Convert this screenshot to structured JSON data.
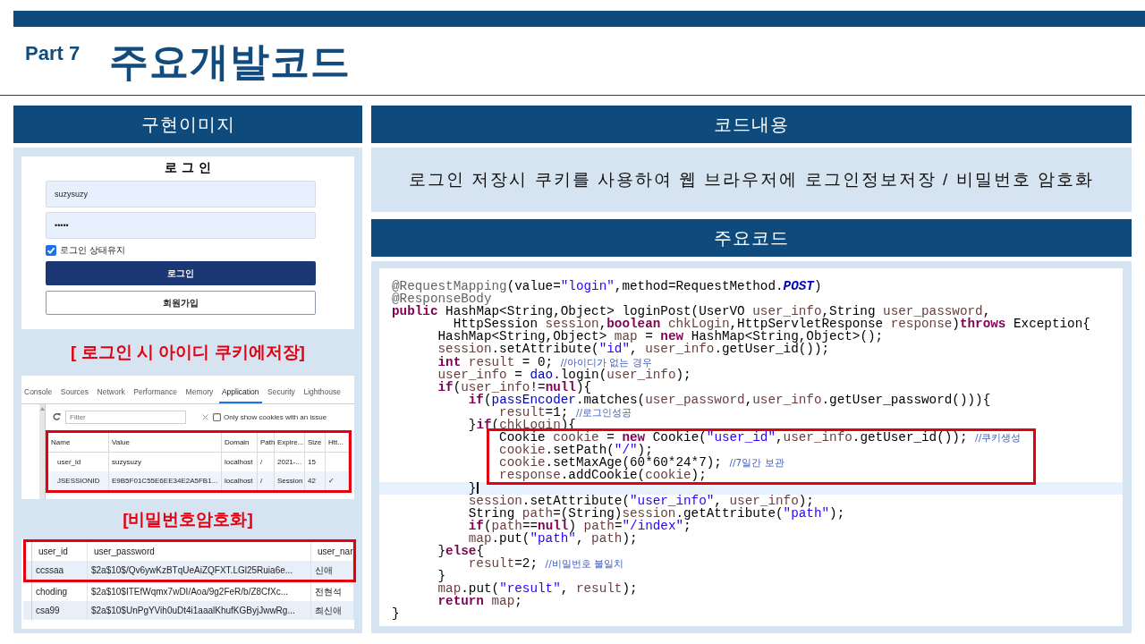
{
  "header": {
    "part": "Part 7",
    "title": "주요개발코드"
  },
  "left": {
    "heading": "구현이미지",
    "login_form": {
      "title": "로그인",
      "username": "suzysuzy",
      "password": "•••••",
      "remember": {
        "label": "로그인 상태유지",
        "checked": true
      },
      "buttons": [
        {
          "label": "로그인",
          "kind": "primary"
        },
        {
          "label": "회원가입",
          "kind": "outline"
        }
      ]
    },
    "caption_1": "[ 로그인 시 아이디 쿠키에저장]",
    "devtools": {
      "tabs": [
        {
          "label": "Console",
          "selected": false
        },
        {
          "label": "Sources",
          "selected": false
        },
        {
          "label": "Network",
          "selected": false
        },
        {
          "label": "Performance",
          "selected": false
        },
        {
          "label": "Memory",
          "selected": false
        },
        {
          "label": "Application",
          "selected": true
        },
        {
          "label": "Security",
          "selected": false
        },
        {
          "label": "Lighthouse",
          "selected": false
        }
      ],
      "filter": {
        "placeholder": "Filter"
      },
      "issue_filter": {
        "label": "Only show cookies with an issue",
        "checked": false
      },
      "cookies": {
        "highlighted": true,
        "columns": [
          "Name",
          "Value",
          "Domain",
          "Path",
          "Expire...",
          "Size",
          "Htt..."
        ],
        "rows": [
          {
            "cells": [
              "user_id",
              "suzysuzy",
              "localhost",
              "/",
              "2021-...",
              "15"
            ]
          },
          {
            "cells": [
              "JSESSIONID",
              "E9B5F01C55E6EE34E2A5FB1...",
              "localhost",
              "/",
              "Session",
              "42",
              "✓"
            ]
          }
        ]
      }
    },
    "caption_2": "[비밀번호암호화]",
    "user_table": {
      "columns": [
        "user_id",
        "user_password",
        "user_nar"
      ],
      "rows": [
        {
          "cells": [
            "ccssaa",
            "$2a$10$/Qv6ywKzBTqUeAiZQFXT.LGl25Ruia6e...",
            "신애"
          ],
          "highlighted": true
        },
        {
          "cells": [
            "choding",
            "$2a$10$ITEfWqmx7wDI/Aoa/9g2FeR/b/Z8CfXc...",
            "전현석"
          ],
          "highlighted": false
        },
        {
          "cells": [
            "csa99",
            "$2a$10$UnPgYVih0uDt4i1aaalKhufKGByjJwwRg...",
            "최신애"
          ],
          "highlighted": false
        }
      ]
    }
  },
  "right": {
    "heading": "코드내용",
    "description": "로그인 저장시 쿠키를 사용하여 웹 브라우저에 로그인정보저장 / 비밀번호 암호화",
    "code_heading": "주요코드",
    "code": {
      "lines": [
        {
          "kind": "code",
          "current": false,
          "tokens": [
            {
              "kind": "annotation",
              "text": "@RequestMapping"
            },
            {
              "kind": "plain",
              "text": "(value="
            },
            {
              "kind": "string",
              "text": "\"login\""
            },
            {
              "kind": "plain",
              "text": ",method=RequestMethod."
            },
            {
              "kind": "constant",
              "text": "POST"
            },
            {
              "kind": "plain",
              "text": ")"
            }
          ]
        },
        {
          "kind": "code",
          "current": false,
          "tokens": [
            {
              "kind": "annotation",
              "text": "@ResponseBody"
            }
          ]
        },
        {
          "kind": "code",
          "current": false,
          "tokens": [
            {
              "kind": "keyword",
              "text": "public"
            },
            {
              "kind": "plain",
              "text": " HashMap<String,Object> loginPost(UserVO "
            },
            {
              "kind": "variable",
              "text": "user_info"
            },
            {
              "kind": "plain",
              "text": ",String "
            },
            {
              "kind": "variable",
              "text": "user_password"
            },
            {
              "kind": "plain",
              "text": ","
            }
          ],
          "children": [
            {
              "kind": "wrap",
              "current": false,
              "tokens": [
                {
                  "kind": "plain",
                  "text": "HttpSession "
                },
                {
                  "kind": "variable",
                  "text": "session"
                },
                {
                  "kind": "plain",
                  "text": ","
                },
                {
                  "kind": "keyword",
                  "text": "boolean "
                },
                {
                  "kind": "variable",
                  "text": "chkLogin"
                },
                {
                  "kind": "plain",
                  "text": ",HttpServletResponse "
                },
                {
                  "kind": "variable",
                  "text": "response"
                },
                {
                  "kind": "plain",
                  "text": ")"
                },
                {
                  "kind": "keyword",
                  "text": "throws"
                },
                {
                  "kind": "plain",
                  "text": " Exception{"
                }
              ]
            },
            {
              "kind": "code",
              "current": false,
              "tokens": [
                {
                  "kind": "plain",
                  "text": "HashMap<String,Object> "
                },
                {
                  "kind": "variable",
                  "text": "map"
                },
                {
                  "kind": "plain",
                  "text": " = "
                },
                {
                  "kind": "keyword",
                  "text": "new"
                },
                {
                  "kind": "plain",
                  "text": " HashMap<String,Object>();"
                }
              ]
            },
            {
              "kind": "code",
              "current": false,
              "tokens": [
                {
                  "kind": "variable",
                  "text": "session"
                },
                {
                  "kind": "plain",
                  "text": ".setAttribute("
                },
                {
                  "kind": "string",
                  "text": "\"id\""
                },
                {
                  "kind": "plain",
                  "text": ", "
                },
                {
                  "kind": "variable",
                  "text": "user_info"
                },
                {
                  "kind": "plain",
                  "text": ".getUser_id());"
                }
              ]
            },
            {
              "kind": "code",
              "current": false,
              "tokens": [
                {
                  "kind": "keyword",
                  "text": "int "
                },
                {
                  "kind": "variable",
                  "text": "result"
                },
                {
                  "kind": "plain",
                  "text": " = 0; "
                },
                {
                  "kind": "comment",
                  "text": "//아이디가 없는 경우"
                }
              ]
            },
            {
              "kind": "code",
              "current": false,
              "tokens": [
                {
                  "kind": "variable",
                  "text": "user_info"
                },
                {
                  "kind": "plain",
                  "text": " = "
                },
                {
                  "kind": "field",
                  "text": "dao"
                },
                {
                  "kind": "plain",
                  "text": ".login("
                },
                {
                  "kind": "variable",
                  "text": "user_info"
                },
                {
                  "kind": "plain",
                  "text": ");"
                }
              ]
            },
            {
              "kind": "code",
              "current": false,
              "tokens": [
                {
                  "kind": "keyword",
                  "text": "if"
                },
                {
                  "kind": "plain",
                  "text": "("
                },
                {
                  "kind": "variable",
                  "text": "user_info"
                },
                {
                  "kind": "plain",
                  "text": "!="
                },
                {
                  "kind": "keyword",
                  "text": "null"
                },
                {
                  "kind": "plain",
                  "text": "){"
                }
              ],
              "children": [
                {
                  "kind": "code",
                  "current": false,
                  "tokens": [
                    {
                      "kind": "keyword",
                      "text": "if"
                    },
                    {
                      "kind": "plain",
                      "text": "("
                    },
                    {
                      "kind": "field",
                      "text": "passEncoder"
                    },
                    {
                      "kind": "plain",
                      "text": ".matches("
                    },
                    {
                      "kind": "variable",
                      "text": "user_password"
                    },
                    {
                      "kind": "plain",
                      "text": ","
                    },
                    {
                      "kind": "variable",
                      "text": "user_info"
                    },
                    {
                      "kind": "plain",
                      "text": ".getUser_password())){"
                    }
                  ],
                  "children": [
                    {
                      "kind": "code",
                      "current": false,
                      "tokens": [
                        {
                          "kind": "variable",
                          "text": "result"
                        },
                        {
                          "kind": "plain",
                          "text": "=1; "
                        },
                        {
                          "kind": "comment",
                          "text": "//로그인성공"
                        }
                      ]
                    }
                  ]
                },
                {
                  "kind": "code",
                  "current": false,
                  "tokens": [
                    {
                      "kind": "plain",
                      "text": "}"
                    },
                    {
                      "kind": "keyword",
                      "text": "if"
                    },
                    {
                      "kind": "plain",
                      "text": "("
                    },
                    {
                      "kind": "variable",
                      "text": "chkLogin"
                    },
                    {
                      "kind": "plain",
                      "text": "){"
                    }
                  ],
                  "children": [
                    {
                      "kind": "box",
                      "lines": [
                        {
                          "kind": "code",
                          "current": false,
                          "tokens": [
                            {
                              "kind": "plain",
                              "text": "Cookie "
                            },
                            {
                              "kind": "variable",
                              "text": "cookie"
                            },
                            {
                              "kind": "plain",
                              "text": " = "
                            },
                            {
                              "kind": "keyword",
                              "text": "new"
                            },
                            {
                              "kind": "plain",
                              "text": " Cookie("
                            },
                            {
                              "kind": "string",
                              "text": "\"user_id\""
                            },
                            {
                              "kind": "plain",
                              "text": ","
                            },
                            {
                              "kind": "variable",
                              "text": "user_info"
                            },
                            {
                              "kind": "plain",
                              "text": ".getUser_id()); "
                            },
                            {
                              "kind": "comment",
                              "text": "//쿠키생성"
                            }
                          ]
                        },
                        {
                          "kind": "code",
                          "current": false,
                          "tokens": [
                            {
                              "kind": "variable",
                              "text": "cookie"
                            },
                            {
                              "kind": "plain",
                              "text": ".setPath("
                            },
                            {
                              "kind": "string",
                              "text": "\"/\""
                            },
                            {
                              "kind": "plain",
                              "text": ");"
                            }
                          ]
                        },
                        {
                          "kind": "code",
                          "current": false,
                          "tokens": [
                            {
                              "kind": "variable",
                              "text": "cookie"
                            },
                            {
                              "kind": "plain",
                              "text": ".setMaxAge(60*60*24*7); "
                            },
                            {
                              "kind": "comment",
                              "text": "//7일간 보관"
                            }
                          ]
                        },
                        {
                          "kind": "code",
                          "current": false,
                          "tokens": [
                            {
                              "kind": "variable",
                              "text": "response"
                            },
                            {
                              "kind": "plain",
                              "text": ".addCookie("
                            },
                            {
                              "kind": "variable",
                              "text": "cookie"
                            },
                            {
                              "kind": "plain",
                              "text": ");"
                            }
                          ]
                        }
                      ]
                    }
                  ]
                },
                {
                  "kind": "code",
                  "current": true,
                  "tokens": [
                    {
                      "kind": "plain",
                      "text": "}"
                    }
                  ]
                },
                {
                  "kind": "code",
                  "current": false,
                  "tokens": [
                    {
                      "kind": "variable",
                      "text": "session"
                    },
                    {
                      "kind": "plain",
                      "text": ".setAttribute("
                    },
                    {
                      "kind": "string",
                      "text": "\"user_info\""
                    },
                    {
                      "kind": "plain",
                      "text": ", "
                    },
                    {
                      "kind": "variable",
                      "text": "user_info"
                    },
                    {
                      "kind": "plain",
                      "text": ");"
                    }
                  ]
                },
                {
                  "kind": "code",
                  "current": false,
                  "tokens": [
                    {
                      "kind": "plain",
                      "text": "String "
                    },
                    {
                      "kind": "variable",
                      "text": "path"
                    },
                    {
                      "kind": "plain",
                      "text": "=(String)"
                    },
                    {
                      "kind": "variable",
                      "text": "session"
                    },
                    {
                      "kind": "plain",
                      "text": ".getAttribute("
                    },
                    {
                      "kind": "string",
                      "text": "\"path\""
                    },
                    {
                      "kind": "plain",
                      "text": ");"
                    }
                  ]
                },
                {
                  "kind": "code",
                  "current": false,
                  "tokens": [
                    {
                      "kind": "keyword",
                      "text": "if"
                    },
                    {
                      "kind": "plain",
                      "text": "("
                    },
                    {
                      "kind": "variable",
                      "text": "path"
                    },
                    {
                      "kind": "plain",
                      "text": "=="
                    },
                    {
                      "kind": "keyword",
                      "text": "null"
                    },
                    {
                      "kind": "plain",
                      "text": ") "
                    },
                    {
                      "kind": "variable",
                      "text": "path"
                    },
                    {
                      "kind": "plain",
                      "text": "="
                    },
                    {
                      "kind": "string",
                      "text": "\"/index\""
                    },
                    {
                      "kind": "plain",
                      "text": ";"
                    }
                  ]
                },
                {
                  "kind": "code",
                  "current": false,
                  "tokens": [
                    {
                      "kind": "variable",
                      "text": "map"
                    },
                    {
                      "kind": "plain",
                      "text": ".put("
                    },
                    {
                      "kind": "string",
                      "text": "\"path\""
                    },
                    {
                      "kind": "plain",
                      "text": ", "
                    },
                    {
                      "kind": "variable",
                      "text": "path"
                    },
                    {
                      "kind": "plain",
                      "text": ");"
                    }
                  ]
                }
              ]
            },
            {
              "kind": "code",
              "current": false,
              "tokens": [
                {
                  "kind": "plain",
                  "text": "}"
                },
                {
                  "kind": "keyword",
                  "text": "else"
                },
                {
                  "kind": "plain",
                  "text": "{"
                }
              ],
              "children": [
                {
                  "kind": "code",
                  "current": false,
                  "tokens": [
                    {
                      "kind": "variable",
                      "text": "result"
                    },
                    {
                      "kind": "plain",
                      "text": "=2; "
                    },
                    {
                      "kind": "comment",
                      "text": "//비밀번호 불일치"
                    }
                  ]
                }
              ]
            },
            {
              "kind": "code",
              "current": false,
              "tokens": [
                {
                  "kind": "plain",
                  "text": "}"
                }
              ]
            },
            {
              "kind": "code",
              "current": false,
              "tokens": [
                {
                  "kind": "variable",
                  "text": "map"
                },
                {
                  "kind": "plain",
                  "text": ".put("
                },
                {
                  "kind": "string",
                  "text": "\"result\""
                },
                {
                  "kind": "plain",
                  "text": ", "
                },
                {
                  "kind": "variable",
                  "text": "result"
                },
                {
                  "kind": "plain",
                  "text": ");"
                }
              ]
            },
            {
              "kind": "code",
              "current": false,
              "tokens": [
                {
                  "kind": "keyword",
                  "text": "return "
                },
                {
                  "kind": "variable",
                  "text": "map"
                },
                {
                  "kind": "plain",
                  "text": ";"
                }
              ]
            }
          ]
        },
        {
          "kind": "code",
          "current": false,
          "tokens": [
            {
              "kind": "plain",
              "text": "}"
            }
          ]
        }
      ]
    }
  }
}
